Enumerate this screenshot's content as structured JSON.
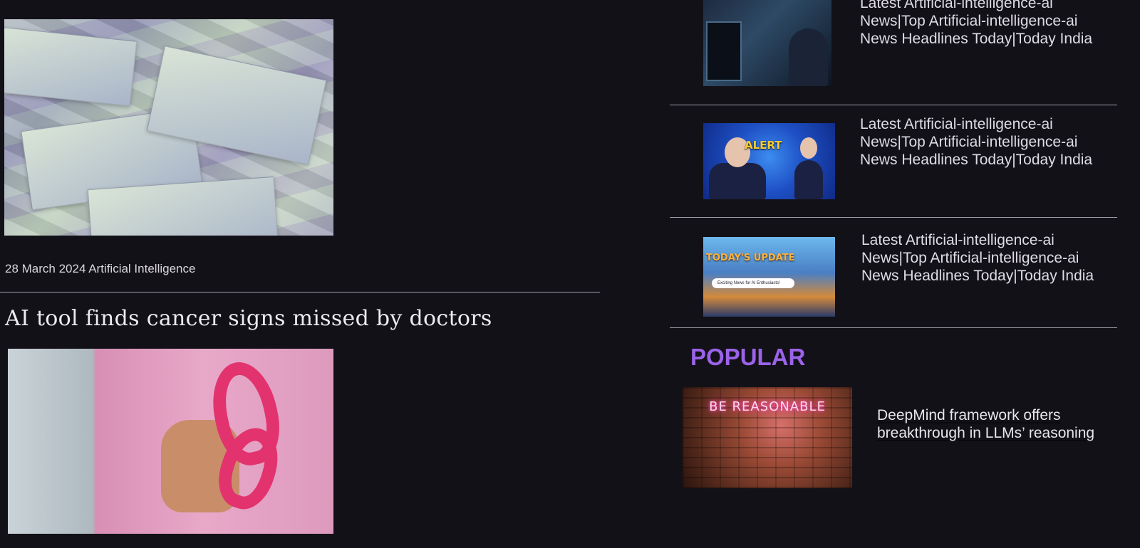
{
  "main": {
    "first_article": {
      "date": "28 March 2024",
      "category": "Artificial Intelligence",
      "image_icon": "banknotes-photo-icon"
    },
    "second_article": {
      "headline": "AI tool finds cancer signs missed by doctors",
      "image_icon": "pink-ribbon-photo-icon"
    }
  },
  "sidebar": {
    "latest_items": [
      {
        "title": "Latest Artificial-intelligence-ai News|Top Artificial-intelligence-ai News Headlines Today|Today India",
        "image_icon": "office-programmer-photo-icon"
      },
      {
        "title": "Latest Artificial-intelligence-ai News|Top Artificial-intelligence-ai News Headlines Today|Today India",
        "image_icon": "news-alert-anchors-photo-icon",
        "image_text": "ALERT"
      },
      {
        "title": "Latest Artificial-intelligence-ai News|Top Artificial-intelligence-ai News Headlines Today|Today India",
        "image_icon": "todays-update-city-photo-icon",
        "image_text": "TODAY'S UPDATE",
        "image_subtext": "Exciting News for AI Enthusiasts!"
      }
    ],
    "popular": {
      "heading": "POPULAR",
      "items": [
        {
          "title": "DeepMind framework offers breakthrough in LLMs’ reasoning",
          "image_icon": "neon-sign-photo-icon",
          "image_text": "BE REASONABLE"
        }
      ]
    }
  },
  "colors": {
    "background": "#131118",
    "popular_accent": "#9b63e8",
    "divider": "#9c9aa4"
  }
}
